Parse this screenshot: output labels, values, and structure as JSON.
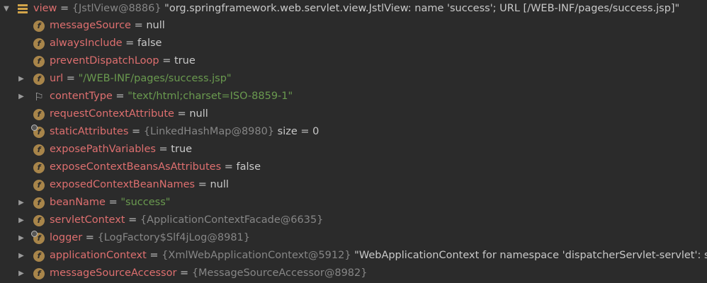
{
  "colors": {
    "background": "#2b2b2b",
    "name": "#de6f6f",
    "string_value": "#6a9a4f",
    "reference": "#868686",
    "plain_text": "#c9c9c9",
    "field_icon": "#a8854a",
    "object_icon": "#d3a54a"
  },
  "root": {
    "name": "view",
    "eq": " = ",
    "ref": "{JstlView@8886}",
    "extra": " \"org.springframework.web.servlet.view.JstlView: name 'success'; URL [/WEB-INF/pages/success.jsp]\"",
    "icon": "object-icon",
    "expanded": true
  },
  "fields": [
    {
      "name": "messageSource",
      "eq": " = ",
      "value": "null"
    },
    {
      "name": "alwaysInclude",
      "eq": " = ",
      "value": "false"
    },
    {
      "name": "preventDispatchLoop",
      "eq": " = ",
      "value": "true"
    },
    {
      "name": "url",
      "eq": " = ",
      "string": "\"/WEB-INF/pages/success.jsp\""
    },
    {
      "name": "contentType",
      "eq": " = ",
      "string": "\"text/html;charset=ISO-8859-1\""
    },
    {
      "name": "requestContextAttribute",
      "eq": " = ",
      "value": "null"
    },
    {
      "name": "staticAttributes",
      "eq": " = ",
      "ref": "{LinkedHashMap@8980}",
      "extra": " size = 0"
    },
    {
      "name": "exposePathVariables",
      "eq": " = ",
      "value": "true"
    },
    {
      "name": "exposeContextBeansAsAttributes",
      "eq": " = ",
      "value": "false"
    },
    {
      "name": "exposedContextBeanNames",
      "eq": " = ",
      "value": "null"
    },
    {
      "name": "beanName",
      "eq": " = ",
      "string": "\"success\""
    },
    {
      "name": "servletContext",
      "eq": " = ",
      "ref": "{ApplicationContextFacade@6635}"
    },
    {
      "name": "logger",
      "eq": " = ",
      "ref": "{LogFactory$Slf4jLog@8981}"
    },
    {
      "name": "applicationContext",
      "eq": " = ",
      "ref": "{XmlWebApplicationContext@5912}",
      "extra": " \"WebApplicationContext for namespace 'dispatcherServlet-servlet': s"
    },
    {
      "name": "messageSourceAccessor",
      "eq": " = ",
      "ref": "{MessageSourceAccessor@8982}"
    }
  ],
  "icons": {
    "field_glyph": "f",
    "flag_glyph": "⚐",
    "collapsed_arrow": "▶",
    "expanded_arrow": "▼"
  }
}
